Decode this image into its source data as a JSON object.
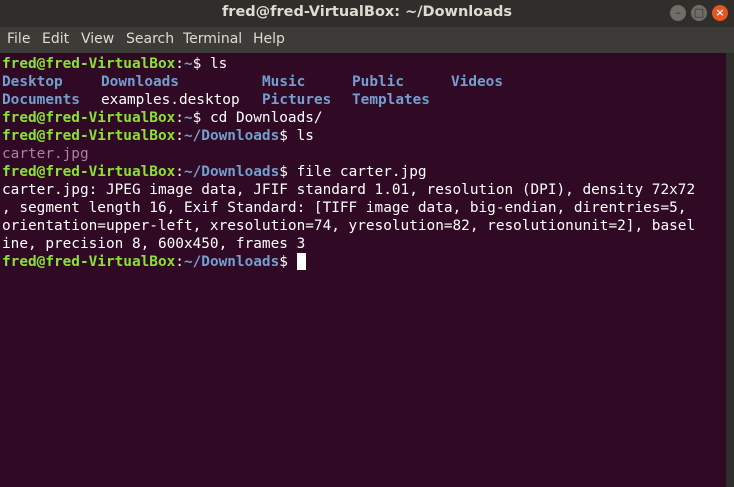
{
  "window": {
    "title": "fred@fred-VirtualBox: ~/Downloads"
  },
  "window_buttons": {
    "minimize": "–",
    "maximize": "□",
    "close": "×"
  },
  "menu": [
    "File",
    "Edit",
    "View",
    "Search",
    "Terminal",
    "Help"
  ],
  "prompt": {
    "user_host": "fred@fred-VirtualBox",
    "home": "~",
    "downloads": "~/Downloads"
  },
  "lines": {
    "l1": {
      "cmd": "ls"
    },
    "l4": {
      "cmd": "cd Downloads/"
    },
    "l5": {
      "cmd": "ls"
    },
    "l6": {
      "file": "carter.jpg"
    },
    "l7": {
      "cmd": "file carter.jpg"
    },
    "l8": {
      "text": "carter.jpg: JPEG image data, JFIF standard 1.01, resolution (DPI), density 72x72"
    },
    "l9": {
      "text": ", segment length 16, Exif Standard: [TIFF image data, big-endian, direntries=5,"
    },
    "l10": {
      "text": "orientation=upper-left, xresolution=74, yresolution=82, resolutionunit=2], basel"
    },
    "l11": {
      "text": "ine, precision 8, 600x450, frames 3"
    }
  },
  "ls_home": {
    "row1": [
      "Desktop",
      "Downloads",
      "Music",
      "Public",
      "Videos"
    ],
    "row2": [
      "Documents",
      "examples.desktop",
      "Pictures",
      "Templates"
    ]
  },
  "colors": {
    "background": "#300a24",
    "prompt_user": "#8ae234",
    "prompt_path": "#729fcf",
    "directory": "#729fcf",
    "image_file": "#ad7fa8",
    "close_button": "#e95420"
  }
}
